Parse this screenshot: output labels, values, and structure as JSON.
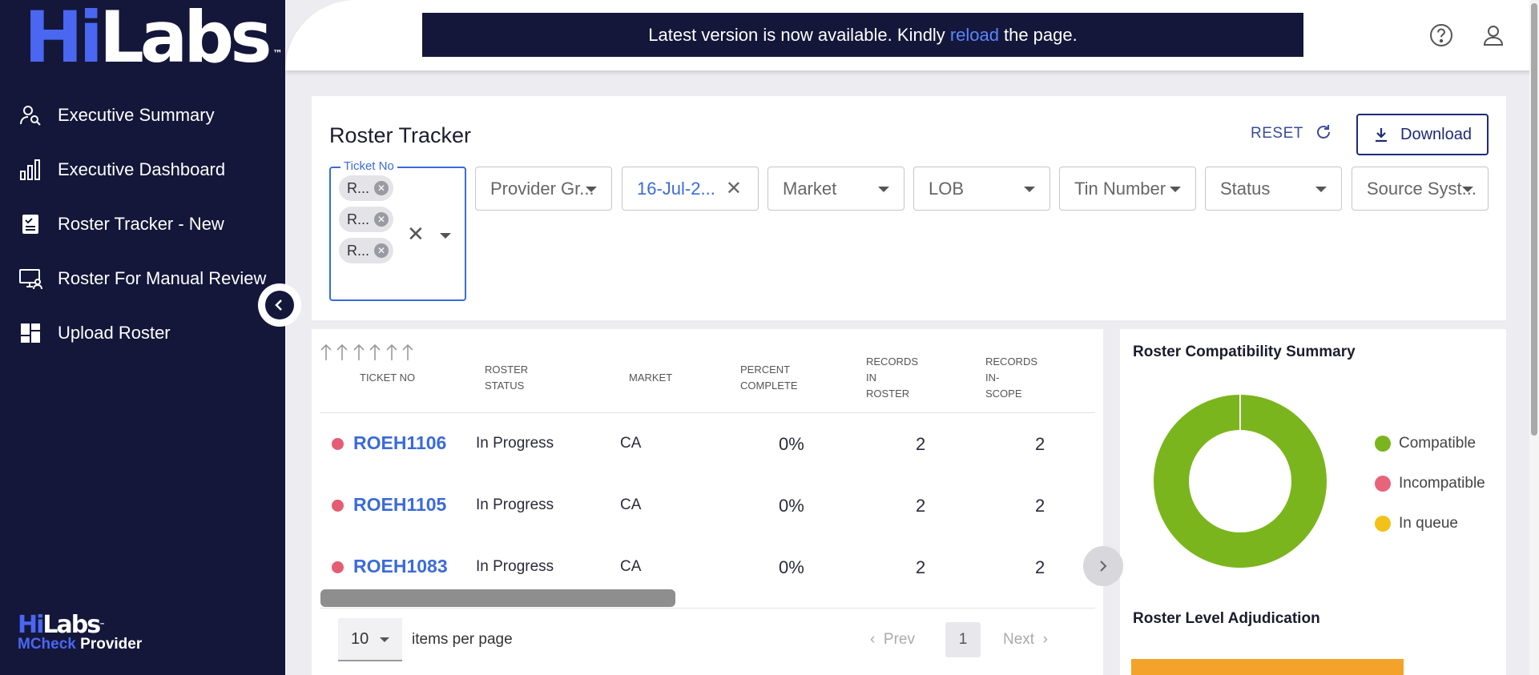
{
  "sidebar": {
    "logo": {
      "hi": "Hi",
      "labs": "Labs",
      "tm": "™"
    },
    "items": [
      {
        "label": "Executive Summary",
        "icon": "user-search-icon"
      },
      {
        "label": "Executive Dashboard",
        "icon": "bar-chart-icon"
      },
      {
        "label": "Roster Tracker - New",
        "icon": "clipboard-check-icon"
      },
      {
        "label": "Roster For Manual Review",
        "icon": "monitor-user-icon"
      },
      {
        "label": "Upload Roster",
        "icon": "dashboard-grid-icon"
      }
    ],
    "footer": {
      "hi": "Hi",
      "labs": "Labs",
      "tm": "™",
      "mcheck": "MCheck",
      "provider": "Provider"
    }
  },
  "banner": {
    "before": "Latest version is now available. Kindly",
    "link": "reload",
    "after": "the page."
  },
  "header": {
    "help_icon": "help-circle-icon",
    "user_icon": "user-icon"
  },
  "filters": {
    "title": "Roster Tracker",
    "reset": "RESET",
    "download": "Download",
    "ticket": {
      "label": "Ticket No",
      "chips": [
        "R...",
        "R...",
        "R..."
      ]
    },
    "selects": [
      {
        "label": "Provider Gr..."
      },
      {
        "label": "16-Jul-2..."
      },
      {
        "label": "Market"
      },
      {
        "label": "LOB"
      },
      {
        "label": "Tin Number"
      },
      {
        "label": "Status"
      },
      {
        "label": "Source Syst..."
      }
    ]
  },
  "table": {
    "columns": [
      [
        "TICKET NO"
      ],
      [
        "ROSTER",
        "STATUS"
      ],
      [
        "MARKET"
      ],
      [
        "PERCENT",
        "COMPLETE"
      ],
      [
        "RECORDS",
        "IN",
        "ROSTER"
      ],
      [
        "RECORDS",
        "IN-",
        "SCOPE"
      ]
    ],
    "rows": [
      {
        "ticket": "ROEH1106",
        "status": "In Progress",
        "market": "CA",
        "percent": "0%",
        "in_roster": "2",
        "in_scope": "2"
      },
      {
        "ticket": "ROEH1105",
        "status": "In Progress",
        "market": "CA",
        "percent": "0%",
        "in_roster": "2",
        "in_scope": "2"
      },
      {
        "ticket": "ROEH1083",
        "status": "In Progress",
        "market": "CA",
        "percent": "0%",
        "in_roster": "2",
        "in_scope": "2"
      }
    ],
    "status_dot_color": "#e45d72",
    "per_page": "10",
    "per_page_label": "items per page",
    "prev": "Prev",
    "page": "1",
    "next": "Next"
  },
  "summary": {
    "title": "Roster Compatibility Summary",
    "legend": [
      {
        "label": "Compatible",
        "color": "#7ab51d"
      },
      {
        "label": "Incompatible",
        "color": "#e8647a"
      },
      {
        "label": "In queue",
        "color": "#f2c21b"
      }
    ],
    "adjudication_title": "Roster Level Adjudication"
  },
  "chart_data": {
    "type": "pie",
    "title": "Roster Compatibility Summary",
    "categories": [
      "Compatible",
      "Incompatible",
      "In queue"
    ],
    "values": [
      100,
      0,
      0
    ]
  }
}
